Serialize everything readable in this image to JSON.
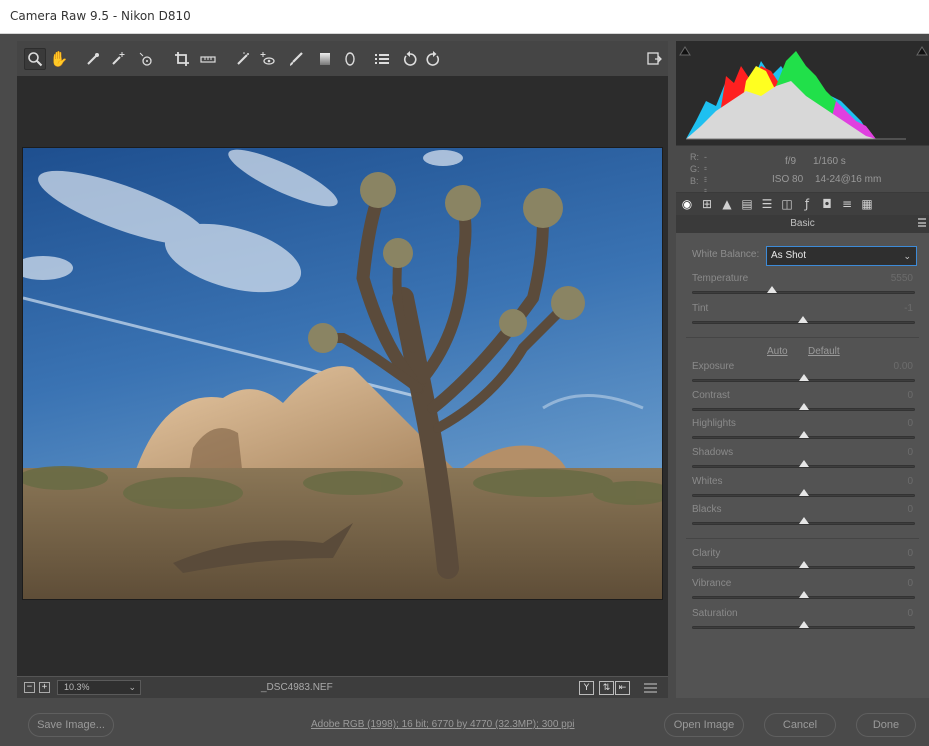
{
  "window": {
    "title": "Camera Raw 9.5  -  Nikon D810"
  },
  "toolbar": {
    "tools": [
      {
        "name": "zoom-tool",
        "icon": "magnifier-icon"
      },
      {
        "name": "hand-tool",
        "icon": "hand-icon"
      },
      {
        "name": "white-balance-tool",
        "icon": "eyedropper-icon"
      },
      {
        "name": "color-sampler-tool",
        "icon": "eyedropper-plus-icon"
      },
      {
        "name": "targeted-adjustment-tool",
        "icon": "target-icon"
      },
      {
        "name": "crop-tool",
        "icon": "crop-icon"
      },
      {
        "name": "straighten-tool",
        "icon": "level-icon"
      },
      {
        "name": "spot-removal-tool",
        "icon": "brush-icon"
      },
      {
        "name": "red-eye-tool",
        "icon": "eye-plus-icon"
      },
      {
        "name": "adjustment-brush",
        "icon": "paint-brush-icon"
      },
      {
        "name": "graduated-filter",
        "icon": "gradient-icon"
      },
      {
        "name": "radial-filter",
        "icon": "ellipse-icon"
      },
      {
        "name": "preferences",
        "icon": "list-icon"
      },
      {
        "name": "rotate-left",
        "icon": "rotate-ccw-icon"
      },
      {
        "name": "rotate-right",
        "icon": "rotate-cw-icon"
      }
    ],
    "fullscreen_icon": "fullscreen-icon"
  },
  "status": {
    "zoom": "10.3%",
    "filename": "_DSC4983.NEF"
  },
  "info": {
    "r_label": "R:",
    "g_label": "G:",
    "b_label": "B:",
    "r_value": "---",
    "g_value": "---",
    "b_value": "---",
    "aperture": "f/9",
    "shutter": "1/160 s",
    "iso": "ISO 80",
    "lens": "14-24@16 mm"
  },
  "panel": {
    "title": "Basic",
    "white_balance_label": "White Balance:",
    "white_balance_value": "As Shot",
    "auto_link": "Auto",
    "default_link": "Default",
    "sliders": [
      {
        "label": "Temperature",
        "value": "5550",
        "position": 0.36
      },
      {
        "label": "Tint",
        "value": "-1",
        "position": 0.497
      },
      {
        "label": "Exposure",
        "value": "0.00",
        "position": 0.5
      },
      {
        "label": "Contrast",
        "value": "0",
        "position": 0.5
      },
      {
        "label": "Highlights",
        "value": "0",
        "position": 0.5
      },
      {
        "label": "Shadows",
        "value": "0",
        "position": 0.5
      },
      {
        "label": "Whites",
        "value": "0",
        "position": 0.5
      },
      {
        "label": "Blacks",
        "value": "0",
        "position": 0.5
      },
      {
        "label": "Clarity",
        "value": "0",
        "position": 0.5
      },
      {
        "label": "Vibrance",
        "value": "0",
        "position": 0.5
      },
      {
        "label": "Saturation",
        "value": "0",
        "position": 0.5
      }
    ]
  },
  "footer": {
    "save_label": "Save Image...",
    "workflow": "Adobe RGB (1998); 16 bit; 6770 by 4770 (32.3MP); 300 ppi",
    "open_label": "Open Image",
    "cancel_label": "Cancel",
    "done_label": "Done"
  }
}
